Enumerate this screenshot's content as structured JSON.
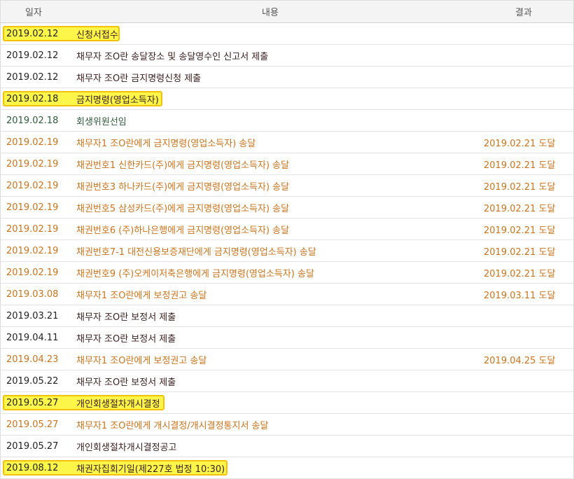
{
  "header": {
    "date": "일자",
    "content": "내용",
    "result": "결과"
  },
  "rows": [
    {
      "date": "2019.02.12",
      "content": "신청서접수",
      "result": "",
      "style": "black",
      "highlight": true,
      "hl_width": 167
    },
    {
      "date": "2019.02.12",
      "content": "채무자 조O란 송달장소 및 송달영수인 신고서 제출",
      "result": "",
      "style": "black",
      "highlight": false
    },
    {
      "date": "2019.02.12",
      "content": "채무자 조O란 금지명령신청 제출",
      "result": "",
      "style": "black",
      "highlight": false
    },
    {
      "date": "2019.02.18",
      "content": "금지명령(영업소득자)",
      "result": "",
      "style": "black",
      "highlight": true,
      "hl_width": 228
    },
    {
      "date": "2019.02.18",
      "content": "회생위원선임",
      "result": "",
      "style": "green",
      "highlight": false
    },
    {
      "date": "2019.02.19",
      "content": "채무자1 조O란에게 금지명령(영업소득자) 송달",
      "result": "2019.02.21 도달",
      "style": "orange",
      "highlight": false
    },
    {
      "date": "2019.02.19",
      "content": "채권번호1 신한카드(주)에게 금지명령(영업소득자) 송달",
      "result": "2019.02.21 도달",
      "style": "orange",
      "highlight": false
    },
    {
      "date": "2019.02.19",
      "content": "채권번호3 하나카드(주)에게 금지명령(영업소득자) 송달",
      "result": "2019.02.21 도달",
      "style": "orange",
      "highlight": false
    },
    {
      "date": "2019.02.19",
      "content": "채권번호5 삼성카드(주)에게 금지명령(영업소득자) 송달",
      "result": "2019.02.21 도달",
      "style": "orange",
      "highlight": false
    },
    {
      "date": "2019.02.19",
      "content": "채권번호6 (주)하나은행에게 금지명령(영업소득자) 송달",
      "result": "2019.02.21 도달",
      "style": "orange",
      "highlight": false
    },
    {
      "date": "2019.02.19",
      "content": "채권번호7-1 대전신용보증재단에게 금지명령(영업소득자) 송달",
      "result": "2019.02.21 도달",
      "style": "orange",
      "highlight": false
    },
    {
      "date": "2019.02.19",
      "content": "채권번호9 (주)오케이저축은행에게 금지명령(영업소득자) 송달",
      "result": "2019.02.21 도달",
      "style": "orange",
      "highlight": false
    },
    {
      "date": "2019.03.08",
      "content": "채무자1 조O란에게 보정권고 송달",
      "result": "2019.03.11 도달",
      "style": "orange",
      "highlight": false
    },
    {
      "date": "2019.03.21",
      "content": "채무자 조O란 보정서 제출",
      "result": "",
      "style": "black",
      "highlight": false
    },
    {
      "date": "2019.04.11",
      "content": "채무자 조O란 보정서 제출",
      "result": "",
      "style": "black",
      "highlight": false
    },
    {
      "date": "2019.04.23",
      "content": "채무자1 조O란에게 보정권고 송달",
      "result": "2019.04.25 도달",
      "style": "orange",
      "highlight": false
    },
    {
      "date": "2019.05.22",
      "content": "채무자 조O란 보정서 제출",
      "result": "",
      "style": "black",
      "highlight": false
    },
    {
      "date": "2019.05.27",
      "content": "개인회생절차개시결정",
      "result": "",
      "style": "black",
      "highlight": true,
      "hl_width": 231
    },
    {
      "date": "2019.05.27",
      "content": "채무자1 조O란에게 개시결정/개시결정통지서 송달",
      "result": "",
      "style": "orange",
      "highlight": false
    },
    {
      "date": "2019.05.27",
      "content": "개인회생절차개시결정공고",
      "result": "",
      "style": "black",
      "highlight": false
    },
    {
      "date": "2019.08.12",
      "content": "채권자집회기일(제227호 법정 10:30)",
      "result": "",
      "style": "black",
      "highlight": true,
      "hl_width": 321
    }
  ],
  "colors": {
    "highlight_fill": "#fdf64a",
    "highlight_border": "#f2c20a",
    "orange_text": "#c8741e",
    "green_text": "#2e5a3a"
  }
}
